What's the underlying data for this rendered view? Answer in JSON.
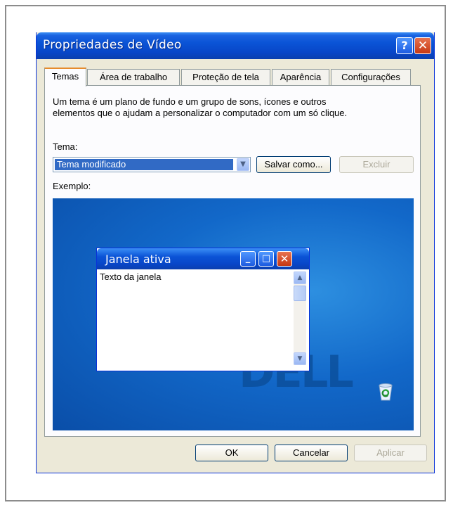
{
  "window": {
    "title": "Propriedades de Vídeo",
    "help_glyph": "?",
    "close_glyph": "✕"
  },
  "tabs": [
    {
      "label": "Temas",
      "active": true
    },
    {
      "label": "Área de trabalho",
      "active": false
    },
    {
      "label": "Proteção de tela",
      "active": false
    },
    {
      "label": "Aparência",
      "active": false
    },
    {
      "label": "Configurações",
      "active": false
    }
  ],
  "themes_tab": {
    "description_line1": "Um tema é um plano de fundo e um grupo de sons, ícones e outros",
    "description_line2": "elementos que o ajudam a personalizar o computador com um só clique.",
    "theme_label": "Tema:",
    "theme_selected": "Tema modificado",
    "save_as_label": "Salvar como...",
    "delete_label": "Excluir",
    "example_label": "Exemplo:"
  },
  "preview": {
    "window_title": "Janela ativa",
    "window_text": "Texto da janela",
    "logo_text": "DELL",
    "icons": [
      "minimize-icon",
      "maximize-icon",
      "close-icon",
      "recycle-bin-icon"
    ]
  },
  "footer": {
    "ok_label": "OK",
    "cancel_label": "Cancelar",
    "apply_label": "Aplicar"
  },
  "colors": {
    "titlebar": "#0a53d6",
    "selection": "#316ac5",
    "dialog_bg": "#ece9d8",
    "active_tab_accent": "#e68b2c"
  }
}
